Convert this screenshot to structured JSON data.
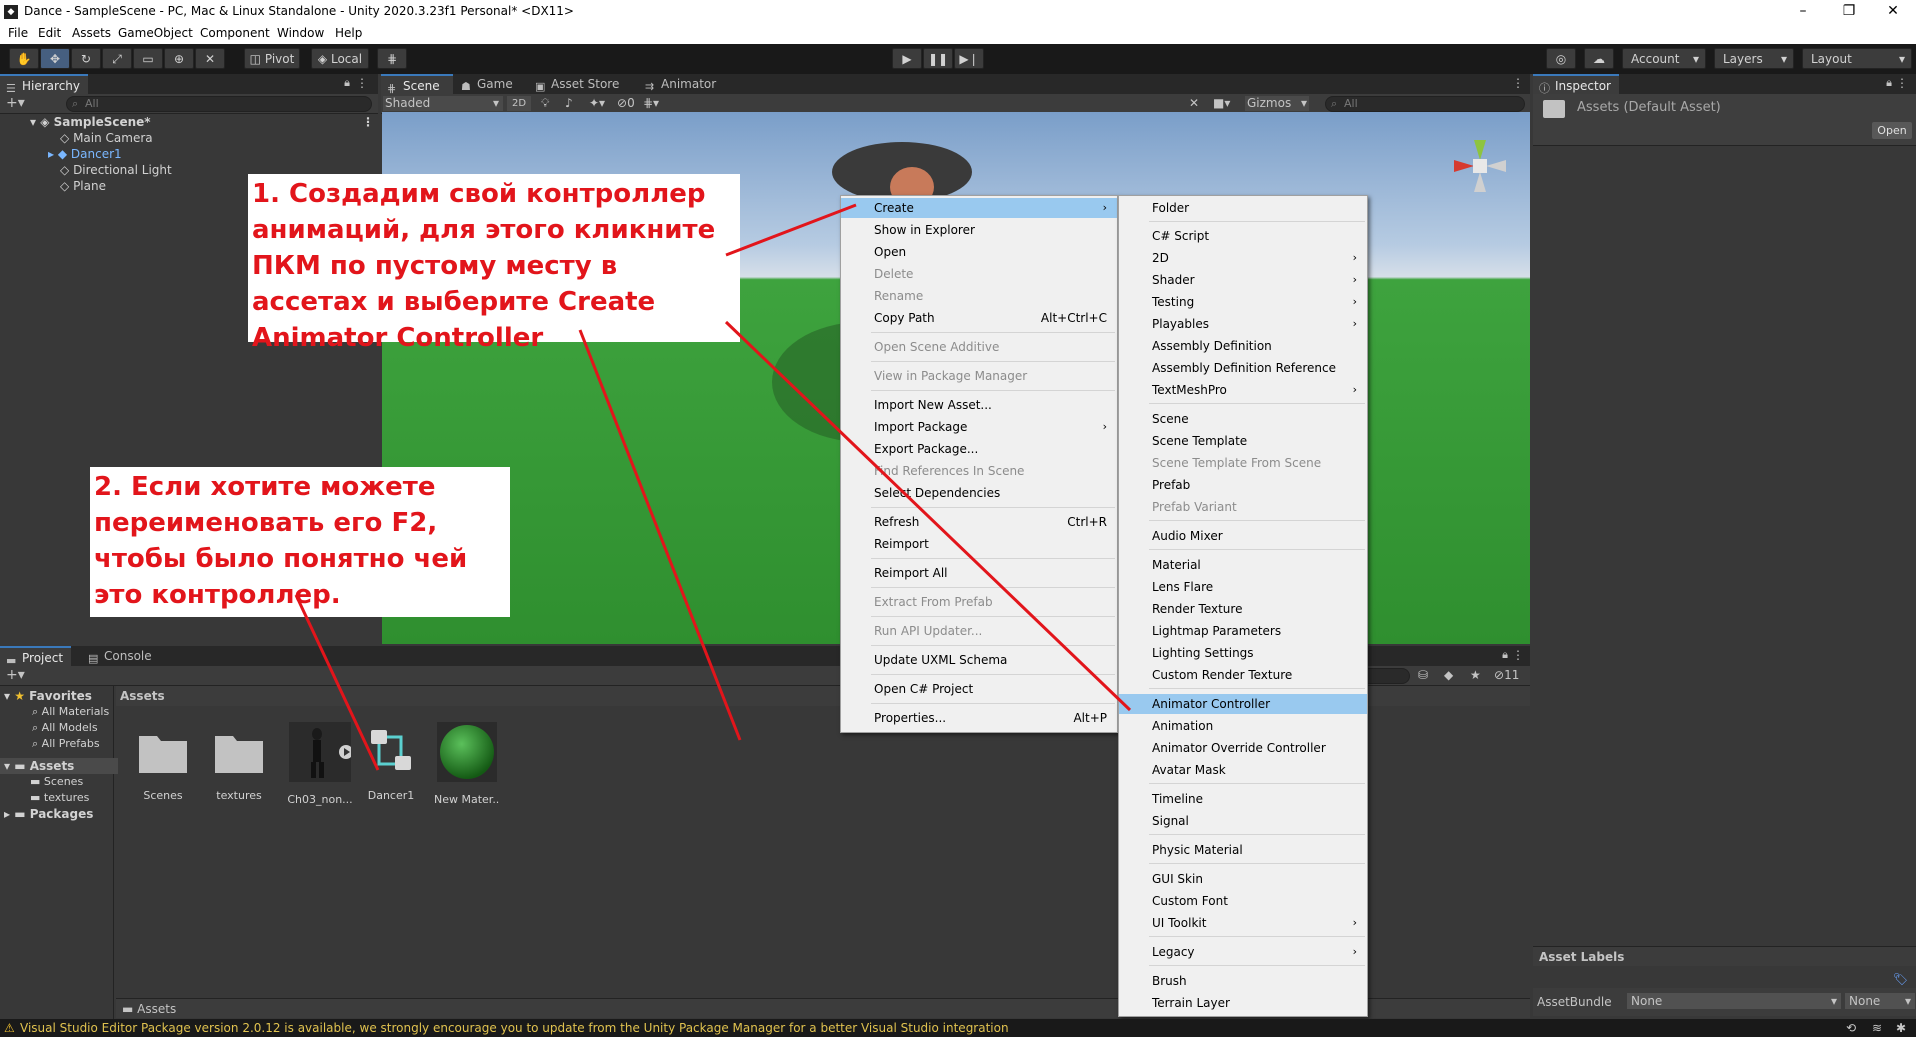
{
  "window": {
    "title": "Dance - SampleScene - PC, Mac & Linux Standalone - Unity 2020.3.23f1 Personal* <DX11>",
    "controls": [
      "–",
      "❐",
      "✕"
    ]
  },
  "menubar": [
    "File",
    "Edit",
    "Assets",
    "GameObject",
    "Component",
    "Window",
    "Help"
  ],
  "toolbar": {
    "pivot": "Pivot",
    "local": "Local",
    "account": "Account",
    "layers": "Layers",
    "layout": "Layout"
  },
  "hierarchy": {
    "tab": "Hierarchy",
    "search_placeholder": "All",
    "scene": "SampleScene*",
    "items": [
      "Main Camera",
      "Dancer1",
      "Directional Light",
      "Plane"
    ]
  },
  "scene": {
    "tabs": [
      "Scene",
      "Game",
      "Asset Store",
      "Animator"
    ],
    "shading": "Shaded",
    "mode2d": "2D",
    "fx_count": "0",
    "gizmos": "Gizmos",
    "search_placeholder": "All"
  },
  "inspector": {
    "tab": "Inspector",
    "title": "Assets (Default Asset)",
    "open": "Open",
    "asset_labels": "Asset Labels",
    "asset_bundle": "AssetBundle",
    "bundle_value": "None",
    "variant_value": "None"
  },
  "project": {
    "tabs": [
      "Project",
      "Console"
    ],
    "favorites": "Favorites",
    "favorite_items": [
      "All Materials",
      "All Models",
      "All Prefabs"
    ],
    "assets_root": "Assets",
    "asset_folders": [
      "Scenes",
      "textures"
    ],
    "packages": "Packages",
    "breadcrumb": "Assets",
    "footer_path": "Assets",
    "hidden_count": "11",
    "items": [
      "Scenes",
      "textures",
      "Ch03_non...",
      "Dancer1",
      "New Mater..."
    ]
  },
  "context_menu": {
    "items": [
      {
        "label": "Create",
        "arrow": "›",
        "highlight": true
      },
      {
        "label": "Show in Explorer"
      },
      {
        "label": "Open"
      },
      {
        "label": "Delete",
        "disabled": true
      },
      {
        "label": "Rename",
        "disabled": true
      },
      {
        "label": "Copy Path",
        "shortcut": "Alt+Ctrl+C"
      },
      {
        "label": "Open Scene Additive",
        "disabled": true
      },
      {
        "label": "View in Package Manager",
        "disabled": true
      },
      {
        "label": "Import New Asset..."
      },
      {
        "label": "Import Package",
        "arrow": "›"
      },
      {
        "label": "Export Package..."
      },
      {
        "label": "Find References In Scene",
        "disabled": true
      },
      {
        "label": "Select Dependencies"
      },
      {
        "label": "Refresh",
        "shortcut": "Ctrl+R"
      },
      {
        "label": "Reimport"
      },
      {
        "label": "Reimport All"
      },
      {
        "label": "Extract From Prefab",
        "disabled": true
      },
      {
        "label": "Run API Updater...",
        "disabled": true
      },
      {
        "label": "Update UXML Schema"
      },
      {
        "label": "Open C# Project"
      },
      {
        "label": "Properties...",
        "shortcut": "Alt+P"
      }
    ]
  },
  "create_submenu": {
    "items": [
      {
        "label": "Folder"
      },
      {
        "label": "C# Script"
      },
      {
        "label": "2D",
        "arrow": "›"
      },
      {
        "label": "Shader",
        "arrow": "›"
      },
      {
        "label": "Testing",
        "arrow": "›"
      },
      {
        "label": "Playables",
        "arrow": "›"
      },
      {
        "label": "Assembly Definition"
      },
      {
        "label": "Assembly Definition Reference"
      },
      {
        "label": "TextMeshPro",
        "arrow": "›"
      },
      {
        "label": "Scene"
      },
      {
        "label": "Scene Template"
      },
      {
        "label": "Scene Template From Scene",
        "disabled": true
      },
      {
        "label": "Prefab"
      },
      {
        "label": "Prefab Variant",
        "disabled": true
      },
      {
        "label": "Audio Mixer"
      },
      {
        "label": "Material"
      },
      {
        "label": "Lens Flare"
      },
      {
        "label": "Render Texture"
      },
      {
        "label": "Lightmap Parameters"
      },
      {
        "label": "Lighting Settings"
      },
      {
        "label": "Custom Render Texture"
      },
      {
        "label": "Animator Controller",
        "highlight": true
      },
      {
        "label": "Animation"
      },
      {
        "label": "Animator Override Controller"
      },
      {
        "label": "Avatar Mask"
      },
      {
        "label": "Timeline"
      },
      {
        "label": "Signal"
      },
      {
        "label": "Physic Material"
      },
      {
        "label": "GUI Skin"
      },
      {
        "label": "Custom Font"
      },
      {
        "label": "UI Toolkit",
        "arrow": "›"
      },
      {
        "label": "Legacy",
        "arrow": "›"
      },
      {
        "label": "Brush"
      },
      {
        "label": "Terrain Layer"
      }
    ]
  },
  "annotations": {
    "note1": "1. Создадим свой контроллер анимаций, для этого кликните ПКМ по пустому месту в ассетах и выберите Create Animator Controller",
    "note2": "2. Если хотите можете переименовать его F2, чтобы было понятно чей это контроллер.",
    "color": "#e2151b"
  },
  "status": {
    "message": "Visual Studio Editor Package version 2.0.12 is available, we strongly encourage you to update from the Unity Package Manager for a better Visual Studio integration"
  },
  "colors": {
    "accent": "#3a79bb",
    "menu_highlight": "#99c9ef",
    "ground": "#3ea33e",
    "sky": "#b6cbe2",
    "warning": "#e0c24f"
  }
}
